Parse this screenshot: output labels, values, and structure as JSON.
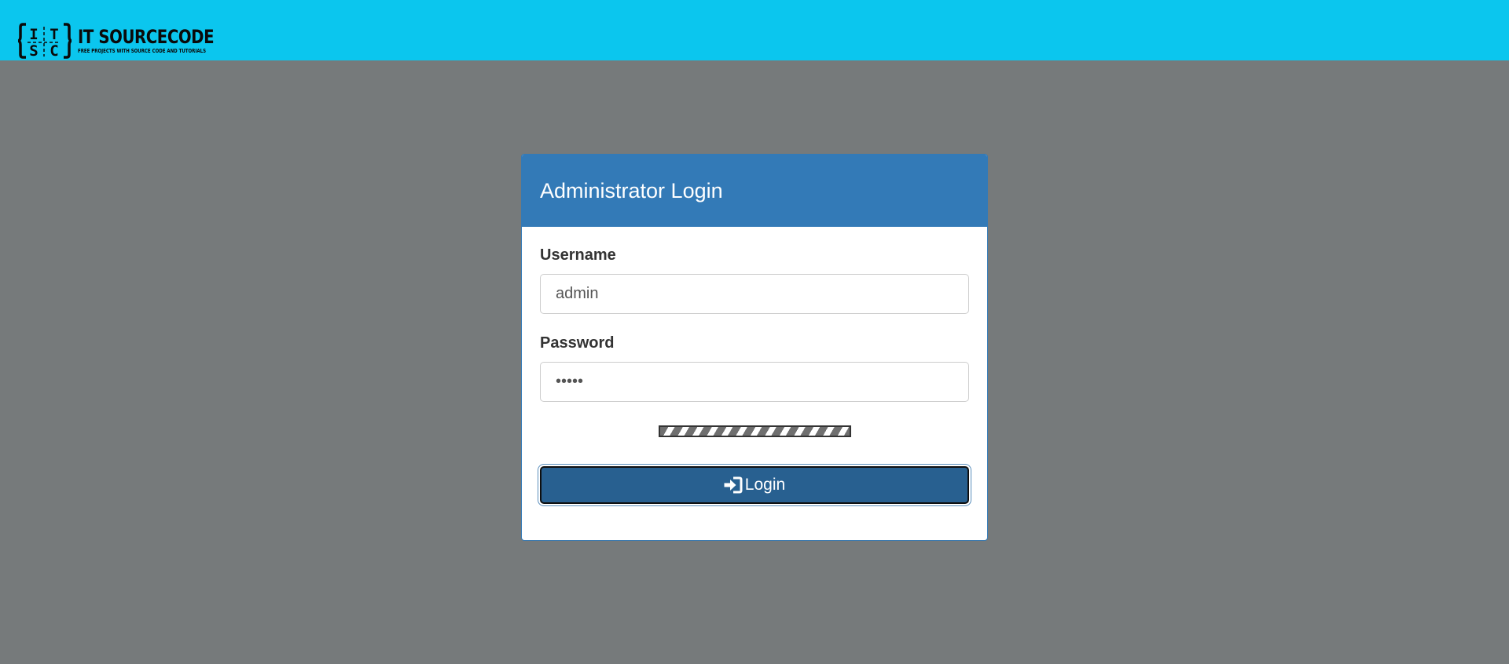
{
  "header": {
    "brand_name": "IT SOURCECODE",
    "brand_tagline": "FREE PROJECTS WITH SOURCE CODE AND TUTORIALS",
    "background_color": "#0bc6ee"
  },
  "login_panel": {
    "title": "Administrator Login",
    "heading_color": "#337ab7",
    "username_label": "Username",
    "username_value": "admin",
    "password_label": "Password",
    "password_value": "•••••",
    "captcha_icon": "captcha-image",
    "login_icon": "sign-in-icon",
    "login_button_label": "Login",
    "button_color": "#286090"
  },
  "page": {
    "background_color": "#767a7b"
  }
}
